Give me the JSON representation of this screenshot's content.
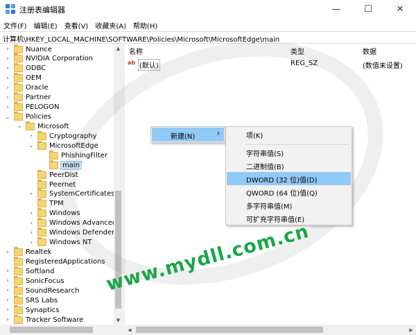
{
  "window": {
    "title": "注册表编辑器",
    "minimize": "—",
    "maximize": "☐",
    "close": "✕"
  },
  "menu": [
    "文件(F)",
    "编辑(E)",
    "查看(V)",
    "收藏夹(A)",
    "帮助(H)"
  ],
  "address": "计算机\\HKEY_LOCAL_MACHINE\\SOFTWARE\\Policies\\Microsoft\\MicrosoftEdge\\main",
  "tree": [
    {
      "label": "Nuance",
      "level": 0,
      "chev": "›"
    },
    {
      "label": "NVIDIA Corporation",
      "level": 0,
      "chev": "›"
    },
    {
      "label": "ODBC",
      "level": 0,
      "chev": "›"
    },
    {
      "label": "OEM",
      "level": 0,
      "chev": "›"
    },
    {
      "label": "Oracle",
      "level": 0,
      "chev": "›"
    },
    {
      "label": "Partner",
      "level": 0,
      "chev": "›"
    },
    {
      "label": "PELOGON",
      "level": 0,
      "chev": "›"
    },
    {
      "label": "Policies",
      "level": 0,
      "chev": "⌄"
    },
    {
      "label": "Microsoft",
      "level": 1,
      "chev": "⌄"
    },
    {
      "label": "Cryptography",
      "level": 2,
      "chev": "›"
    },
    {
      "label": "MicrosoftEdge",
      "level": 2,
      "chev": "⌄"
    },
    {
      "label": "PhishingFilter",
      "level": 3,
      "chev": ""
    },
    {
      "label": "main",
      "level": 3,
      "chev": "",
      "selected": true
    },
    {
      "label": "PeerDist",
      "level": 2,
      "chev": ""
    },
    {
      "label": "Peernet",
      "level": 2,
      "chev": ""
    },
    {
      "label": "SystemCertificates",
      "level": 2,
      "chev": "›"
    },
    {
      "label": "TPM",
      "level": 2,
      "chev": ""
    },
    {
      "label": "Windows",
      "level": 2,
      "chev": "›"
    },
    {
      "label": "Windows Advanced T",
      "level": 2,
      "chev": "›"
    },
    {
      "label": "Windows Defender",
      "level": 2,
      "chev": "›"
    },
    {
      "label": "Windows NT",
      "level": 2,
      "chev": "›"
    },
    {
      "label": "Realtek",
      "level": 0,
      "chev": "›"
    },
    {
      "label": "RegisteredApplications",
      "level": 0,
      "chev": ""
    },
    {
      "label": "Softland",
      "level": 0,
      "chev": "›"
    },
    {
      "label": "SonicFocus",
      "level": 0,
      "chev": "›"
    },
    {
      "label": "SoundResearch",
      "level": 0,
      "chev": "›"
    },
    {
      "label": "SRS Labs",
      "level": 0,
      "chev": "›"
    },
    {
      "label": "Synaptics",
      "level": 0,
      "chev": "›"
    },
    {
      "label": "Tracker Software",
      "level": 0,
      "chev": "›"
    }
  ],
  "columns": {
    "name": "名称",
    "type": "类型",
    "data": "数据"
  },
  "values": [
    {
      "icon": "ab",
      "name": "(默认)",
      "type": "REG_SZ",
      "data": "(数值未设置)"
    }
  ],
  "context_menu": {
    "label": "新建(N)",
    "arrow": "›"
  },
  "submenu": [
    "项(K)",
    "字符串值(S)",
    "二进制值(B)",
    "DWORD (32 位)值(D)",
    "QWORD (64 位)值(Q)",
    "多字符串值(M)",
    "可扩充字符串值(E)"
  ],
  "submenu_highlight_index": 3,
  "watermark": "www.mydll.com.cn",
  "scroll": {
    "up": "▲",
    "down": "▼",
    "left": "◀",
    "right": "▶"
  },
  "colors": {
    "highlight": "#91c9f7",
    "selection": "#cce4f7",
    "folder": "#f5d476",
    "watermark": "#1aa64a"
  }
}
